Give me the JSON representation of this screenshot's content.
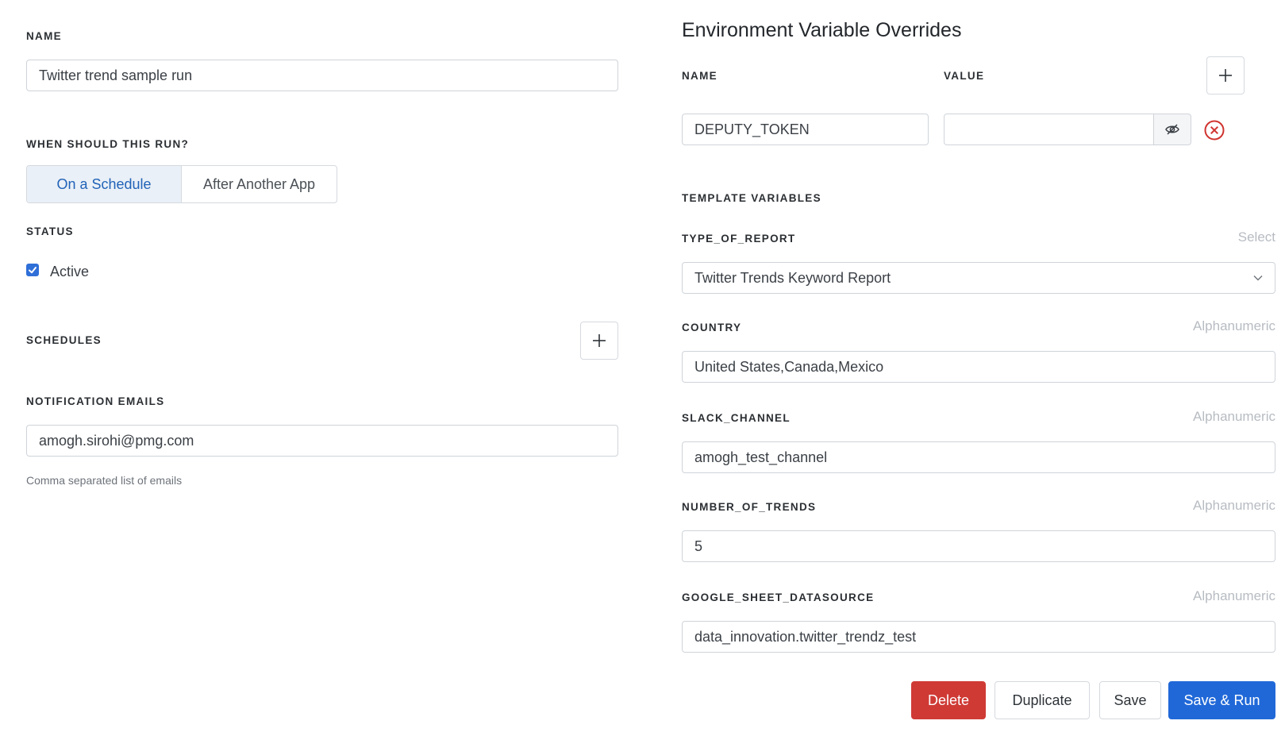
{
  "left": {
    "name_label": "NAME",
    "name_value": "Twitter trend sample run",
    "when_label": "WHEN SHOULD THIS RUN?",
    "when_options": [
      "On a Schedule",
      "After Another App"
    ],
    "status_label": "STATUS",
    "active_label": "Active",
    "schedules_label": "SCHEDULES",
    "emails_label": "NOTIFICATION EMAILS",
    "emails_value": "amogh.sirohi@pmg.com",
    "emails_help": "Comma separated list of emails"
  },
  "env": {
    "title": "Environment Variable Overrides",
    "name_header": "NAME",
    "value_header": "VALUE",
    "rows": [
      {
        "name": "DEPUTY_TOKEN",
        "value": ""
      }
    ]
  },
  "template": {
    "title": "TEMPLATE VARIABLES",
    "vars": [
      {
        "label": "TYPE_OF_REPORT",
        "hint": "Select",
        "value": "Twitter Trends Keyword Report"
      },
      {
        "label": "COUNTRY",
        "hint": "Alphanumeric",
        "value": "United States,Canada,Mexico"
      },
      {
        "label": "SLACK_CHANNEL",
        "hint": "Alphanumeric",
        "value": "amogh_test_channel"
      },
      {
        "label": "NUMBER_OF_TRENDS",
        "hint": "Alphanumeric",
        "value": "5"
      },
      {
        "label": "GOOGLE_SHEET_DATASOURCE",
        "hint": "Alphanumeric",
        "value": "data_innovation.twitter_trendz_test"
      }
    ]
  },
  "actions": {
    "delete": "Delete",
    "duplicate": "Duplicate",
    "save": "Save",
    "save_run": "Save & Run"
  },
  "icons": {
    "add": "plus-icon",
    "visibility": "eye-slash-icon",
    "remove": "close-circle-icon",
    "dropdown": "chevron-down-icon",
    "checkbox": "check-icon"
  },
  "colors": {
    "primary": "#2068d8",
    "danger": "#cf3a35",
    "active_segment_bg": "#eaf0f7",
    "active_segment_text": "#2163b8"
  },
  "status_active": true
}
